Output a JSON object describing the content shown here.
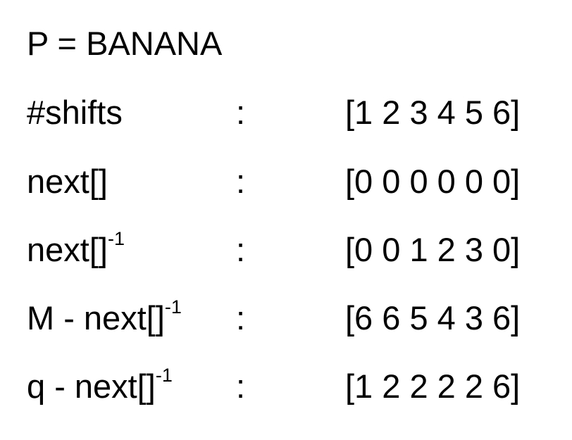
{
  "title": "P = BANANA",
  "colon": ":",
  "rows": [
    {
      "label": "#shifts",
      "superscript": "",
      "values": "[1 2 3 4 5 6]"
    },
    {
      "label": "next[]",
      "superscript": "",
      "values": "[0 0 0 0 0 0]"
    },
    {
      "label": "next[]",
      "superscript": "-1",
      "values": "[0 0 1 2 3 0]"
    },
    {
      "label": "M - next[]",
      "superscript": "-1",
      "values": "[6 6 5 4 3 6]"
    },
    {
      "label": "q - next[]",
      "superscript": "-1",
      "values": "[1 2 2 2 2 6]"
    }
  ]
}
